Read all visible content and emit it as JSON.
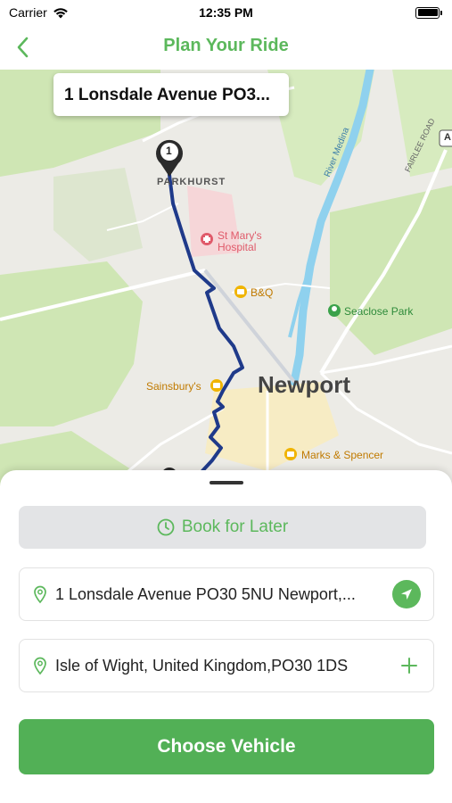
{
  "status_bar": {
    "carrier": "Carrier",
    "time": "12:35 PM"
  },
  "nav": {
    "title": "Plan Your Ride",
    "back_icon": "chevron-left-icon"
  },
  "map": {
    "callout": "1 Lonsdale Avenue PO3...",
    "marker_label": "1",
    "labels": {
      "parkhurst": "PARKHURST",
      "st_marys_line1": "St Mary's",
      "st_marys_line2": "Hospital",
      "bq": "B&Q",
      "seaclose": "Seaclose Park",
      "sainsburys": "Sainsbury's",
      "newport": "Newport",
      "marks": "Marks & Spencer",
      "river": "River Medina",
      "fairlee": "FAIRLEE ROAD",
      "road_badge": "A"
    },
    "colors": {
      "route": "#1f3a8a",
      "water": "#8fd1ee",
      "park": "#cfe6b4"
    }
  },
  "sheet": {
    "book_later": "Book for Later",
    "pickup": "1 Lonsdale Avenue PO30 5NU Newport,...",
    "dropoff": "Isle of Wight, United Kingdom,PO30 1DS",
    "choose_vehicle": "Choose Vehicle"
  },
  "theme": {
    "accent": "#5cb85c"
  }
}
